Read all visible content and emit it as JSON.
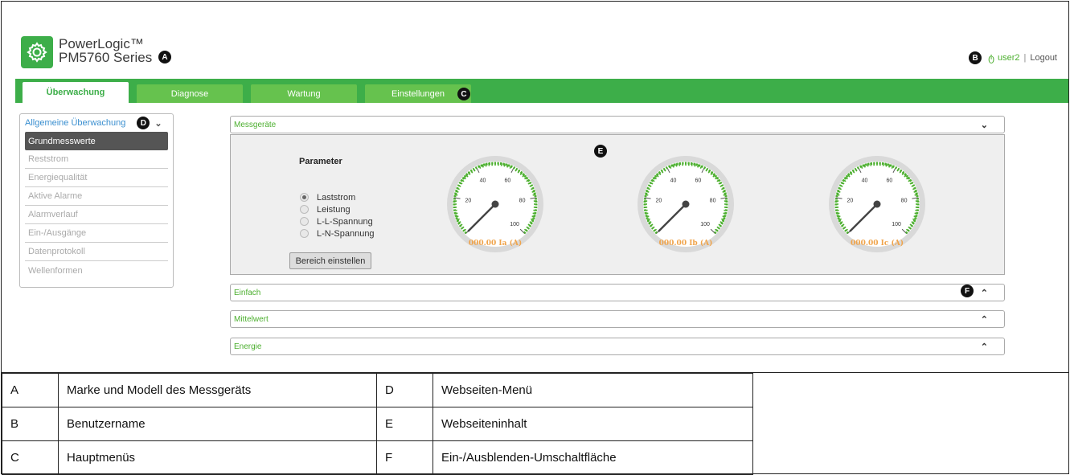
{
  "header": {
    "brand_line1": "PowerLogic™",
    "brand_line2": "PM5760 Series",
    "user_icon": "ტ",
    "username": "user2",
    "separator": "|",
    "logout": "Logout"
  },
  "callouts": {
    "a": "A",
    "b": "B",
    "c": "C",
    "d": "D",
    "e": "E",
    "f": "F"
  },
  "tabs": [
    {
      "label": "Überwachung",
      "active": true
    },
    {
      "label": "Diagnose",
      "active": false
    },
    {
      "label": "Wartung",
      "active": false
    },
    {
      "label": "Einstellungen",
      "active": false
    }
  ],
  "sidemenu": {
    "title": "Allgemeine Überwachung",
    "items": [
      {
        "label": "Grundmesswerte",
        "active": true
      },
      {
        "label": "Reststrom"
      },
      {
        "label": "Energiequalität"
      },
      {
        "label": "Aktive Alarme"
      },
      {
        "label": "Alarmverlauf"
      },
      {
        "label": "Ein-/Ausgänge"
      },
      {
        "label": "Datenprotokoll"
      },
      {
        "label": "Wellenformen"
      }
    ]
  },
  "panels": {
    "messgeraete": "Messgeräte",
    "einfach": "Einfach",
    "mittelwert": "Mittelwert",
    "energie": "Energie"
  },
  "parameter": {
    "title": "Parameter",
    "options": [
      {
        "label": "Laststrom",
        "selected": true
      },
      {
        "label": "Leistung",
        "selected": false
      },
      {
        "label": "L-L-Spannung",
        "selected": false
      },
      {
        "label": "L-N-Spannung",
        "selected": false
      }
    ],
    "button": "Bereich einstellen"
  },
  "gauges": {
    "ticks": [
      "20",
      "40",
      "60",
      "80",
      "100"
    ],
    "items": [
      {
        "label": "000.00 Ia (A)",
        "value": 0
      },
      {
        "label": "000.00 Ib (A)",
        "value": 0
      },
      {
        "label": "000.00 Ic (A)",
        "value": 0
      }
    ]
  },
  "legend": [
    [
      "A",
      "Marke und Modell des Messgeräts",
      "D",
      "Webseiten-Menü"
    ],
    [
      "B",
      "Benutzername",
      "E",
      "Webseiteninhalt"
    ],
    [
      "C",
      "Hauptmenüs",
      "F",
      "Ein-/Ausblenden-Umschaltfläche"
    ]
  ],
  "colors": {
    "brand_green": "#3dae49",
    "tab_green": "#66c24e",
    "link_blue": "#3a8fd0",
    "gauge_orange": "#f0a44b"
  }
}
